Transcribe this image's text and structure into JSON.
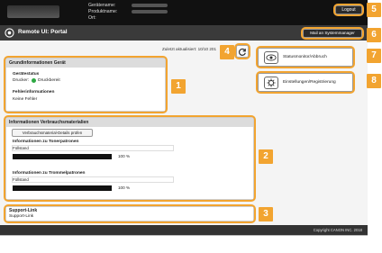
{
  "header": {
    "device_name_label": "Gerätename:",
    "product_name_label": "Produktname:",
    "location_label": "Ort:",
    "logout_label": "Logout"
  },
  "titlebar": {
    "title": "Remote UI: Portal",
    "mail_button": "Mail an Systemmanager"
  },
  "status": {
    "updated_label": "Zuletzt aktualisiert: 10/10 201"
  },
  "device_info": {
    "heading": "Grundinformationen Gerät",
    "device_status_label": "Gerätestatus",
    "printer_label": "Drucker:",
    "printer_status": "Druckbereit",
    "printer_status_color": "#2ea843",
    "error_label": "Fehlerinformationen",
    "error_value": "Keine Fehler"
  },
  "consumables": {
    "heading": "Informationen Verbrauchsmaterialien",
    "check_button": "Verbrauchsmaterial-Details prüfen",
    "toner_heading": "Informationen zu Tonerpatronen",
    "toner_fill_label": "Füllstand",
    "toner_percent": "100 %",
    "toner_level": 1.0,
    "drum_heading": "Informationen zu Trommelpatronen",
    "drum_fill_label": "Füllstand",
    "drum_percent": "100 %",
    "drum_level": 1.0
  },
  "support": {
    "heading": "Support-Link",
    "link": "Support-Link"
  },
  "side": {
    "status_monitor": "Statusmonitor/Abbruch",
    "settings": "Einstellungen/Registrierung"
  },
  "callouts": [
    "1",
    "2",
    "3",
    "4",
    "5",
    "6",
    "7",
    "8"
  ],
  "footer": {
    "copyright": "Copyright CANON INC. 2018"
  },
  "colors": {
    "accent": "#f2a430"
  }
}
